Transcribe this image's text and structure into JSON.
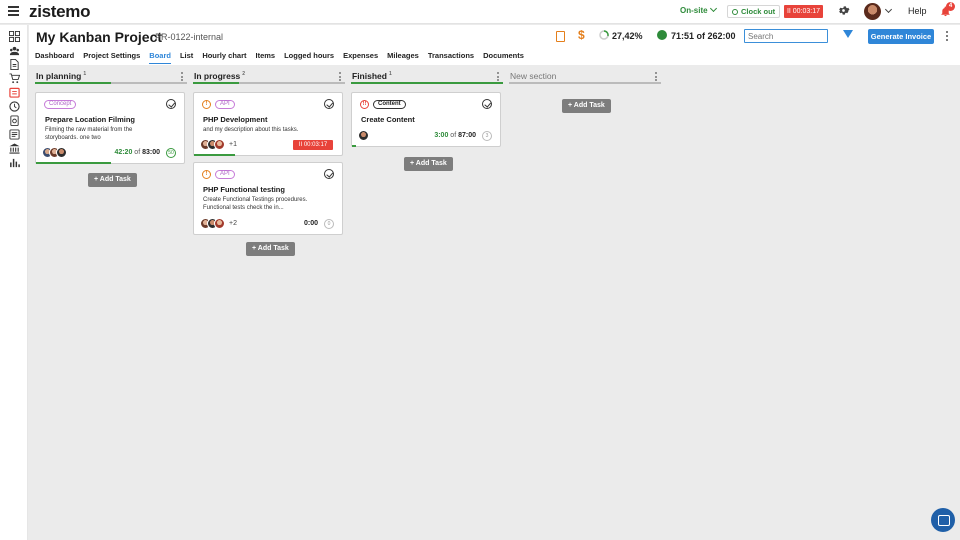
{
  "app": {
    "logo": "zistemo"
  },
  "topbar": {
    "status": "On-site",
    "clock_out": "Clock out",
    "timer": "II 00:03:17",
    "help": "Help",
    "notifications": "4"
  },
  "header": {
    "title": "My Kanban Project",
    "code": "PR-0122-internal",
    "progress": "27,42%",
    "hours": "71:51 of 262:00",
    "search_placeholder": "Search",
    "generate_invoice": "Generate Invoice"
  },
  "tabs": [
    "Dashboard",
    "Project Settings",
    "Board",
    "List",
    "Hourly chart",
    "Items",
    "Logged hours",
    "Expenses",
    "Mileages",
    "Transactions",
    "Documents"
  ],
  "active_tab": "Board",
  "board": {
    "add_task": "+ Add Task",
    "columns": [
      {
        "title": "In planning",
        "count": "1",
        "progress": 0.5,
        "cards": [
          {
            "tag": "Concept",
            "title": "Prepare Location Filming",
            "desc": "Filming the raw material from the storyboards. one two",
            "spent": "42:20",
            "of": "of",
            "total": "83:00",
            "badge": "50",
            "progress": 0.51
          }
        ]
      },
      {
        "title": "In progress",
        "count": "2",
        "progress": 0.3,
        "cards": [
          {
            "priority": "!",
            "tag": "API",
            "title": "PHP Development",
            "desc": "and my description about this tasks.",
            "more": "+1",
            "timer": "II 00:03:17",
            "progress": 0.28
          },
          {
            "priority": "!",
            "tag": "API",
            "title": "PHP Functional testing",
            "desc": "Create Functional Testings procedures. Functional tests check the in...",
            "more": "+2",
            "spent": "0:00",
            "badge": "0"
          }
        ]
      },
      {
        "title": "Finished",
        "count": "1",
        "progress": 1.0,
        "cards": [
          {
            "priority": "!!",
            "tag": "Content",
            "title": "Create Content",
            "spent": "3:00",
            "of": "of",
            "total": "87:00",
            "badge": "3",
            "progress": 0.03
          }
        ]
      },
      {
        "title": "New section",
        "count": "",
        "progress": 0,
        "cards": []
      }
    ]
  }
}
